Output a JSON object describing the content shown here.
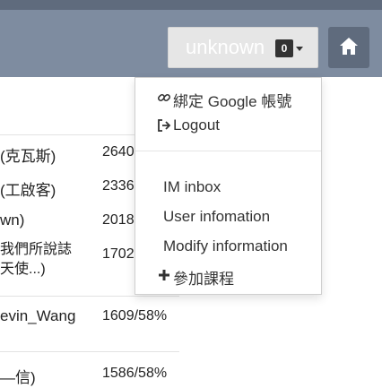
{
  "navbar": {
    "username": "unknown",
    "badge_count": "0"
  },
  "dropdown": {
    "items": [
      {
        "label": "綁定 Google 帳號"
      },
      {
        "label": "Logout"
      },
      {
        "label": "IM inbox"
      },
      {
        "label": "User infomation"
      },
      {
        "label": "Modify information"
      },
      {
        "label": "參加課程"
      }
    ]
  },
  "table": {
    "rows": [
      {
        "name": "(克瓦斯)",
        "value": "2640"
      },
      {
        "name": "(工啟客)",
        "value": "2336"
      },
      {
        "name": "wn)",
        "value": "2018"
      },
      {
        "name": "我們所說誌",
        "value": "1702"
      },
      {
        "name": "天使...)",
        "value": ""
      },
      {
        "name": "evin_Wang",
        "value": "1609/58%"
      },
      {
        "name": "—信)",
        "value": "1586/58%"
      }
    ]
  },
  "colors": {
    "navbar": "#7e8ca0",
    "topband": "#5f6b7d",
    "home_button": "#5f6b7d",
    "user_button": "#e6e6e6"
  }
}
